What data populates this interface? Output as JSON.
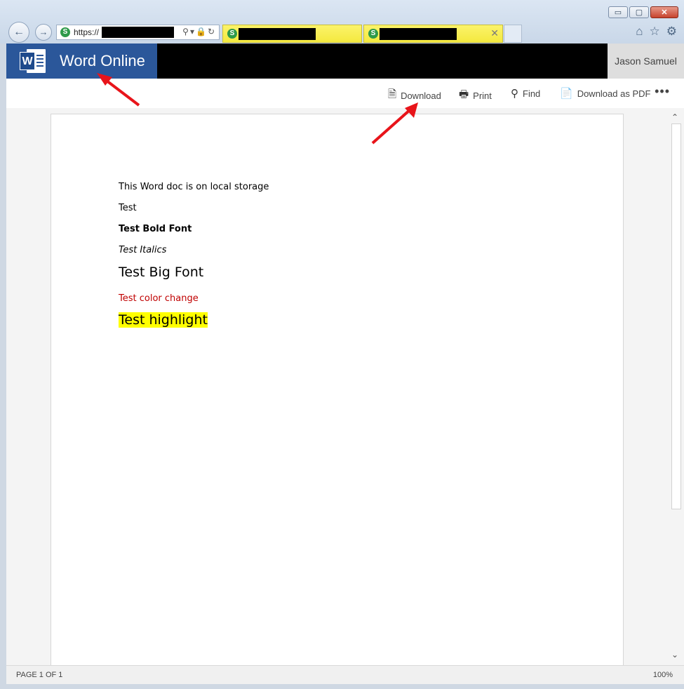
{
  "browser": {
    "address_text": "https://",
    "window_buttons": [
      "▭",
      "▢",
      "✕"
    ]
  },
  "app": {
    "title": "Word Online",
    "user": "Jason Samuel"
  },
  "toolbar": {
    "download": "Download",
    "print": "Print",
    "find": "Find",
    "download_pdf": "Download as PDF",
    "more": "•••"
  },
  "document": {
    "line1": "This Word doc is on local storage",
    "line2": "Test",
    "line3": "Test Bold Font",
    "line4": "Test Italics",
    "line5": "Test Big Font",
    "line6": "Test color change",
    "line7": "Test highlight",
    "color_text": "#c00000",
    "highlight": "#ffff00"
  },
  "status": {
    "page": "PAGE 1 OF 1",
    "zoom": "100%"
  },
  "colors": {
    "brand": "#2b579a",
    "annotation_arrow": "#e8141a"
  }
}
